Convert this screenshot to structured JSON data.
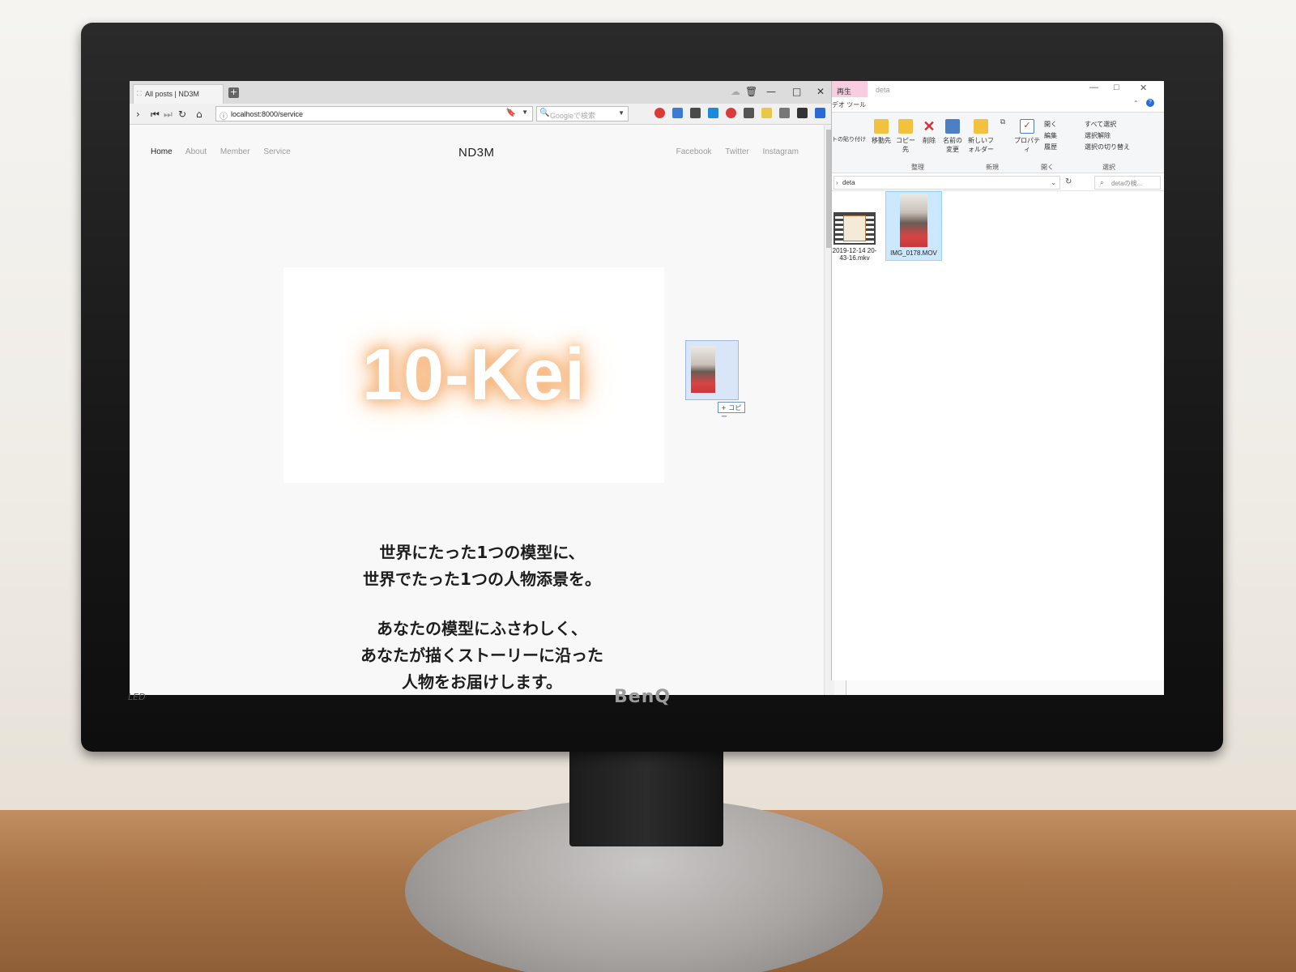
{
  "monitor": {
    "brand": "BenQ",
    "model_badge": "LED"
  },
  "browser": {
    "tab_title": "All posts | ND3M",
    "new_tab_symbol": "+",
    "window_controls": [
      "—",
      "□",
      "✕"
    ],
    "url": "localhost:8000/service",
    "search_placeholder": "Googleで検索",
    "nav_icons": [
      "forward-icon",
      "first-icon",
      "last-icon",
      "reload-icon",
      "home-icon"
    ],
    "extension_colors": [
      "#d93b3b",
      "#3c7bd4",
      "#4a4a4a",
      "#1e88d9",
      "#d93b3b",
      "#555555",
      "#e8c84a",
      "#777777",
      "#333333",
      "#2a6ad6"
    ]
  },
  "site": {
    "nav": [
      "Home",
      "About",
      "Member",
      "Service"
    ],
    "active_nav": "Home",
    "logo": "ND3M",
    "social": [
      "Facebook",
      "Twitter",
      "Instagram"
    ],
    "hero_text": "10-Kei",
    "tagline_lines": [
      "世界にたった1つの模型に、",
      "世界でたった1つの人物添景を。",
      "",
      "あなたの模型にふさわしく、",
      "あなたが描くストーリーに沿った",
      "人物をお届けします。"
    ],
    "drag_copy_label": "+ コピー"
  },
  "explorer": {
    "play_tab": "再生",
    "title": "deta",
    "ribbon_tab": "デオ ツール",
    "clipboard_fragment": "トの貼り付け",
    "buttons": [
      {
        "label": "移動先",
        "color": "#f2c140"
      },
      {
        "label": "コピー先",
        "color": "#f2c140"
      },
      {
        "label": "削除",
        "color": "#d92f2f"
      },
      {
        "label": "名前の変更",
        "color": "#4d7fc4"
      },
      {
        "label": "新しいフォルダー",
        "color": "#f2c140"
      },
      {
        "label": "プロパティ",
        "color": "#4d7fc4"
      }
    ],
    "open_items": [
      "開く",
      "編集",
      "履歴"
    ],
    "select_items": [
      "すべて選択",
      "選択解除",
      "選択の切り替え"
    ],
    "groups": [
      "整理",
      "新規",
      "開く",
      "選択"
    ],
    "address": "deta",
    "search_placeholder": "detaの検...",
    "files": [
      {
        "name": "2019-12-14 20-43-16.mkv",
        "type": "video-film"
      },
      {
        "name": "IMG_0178.MOV",
        "type": "video-thumb"
      }
    ]
  }
}
